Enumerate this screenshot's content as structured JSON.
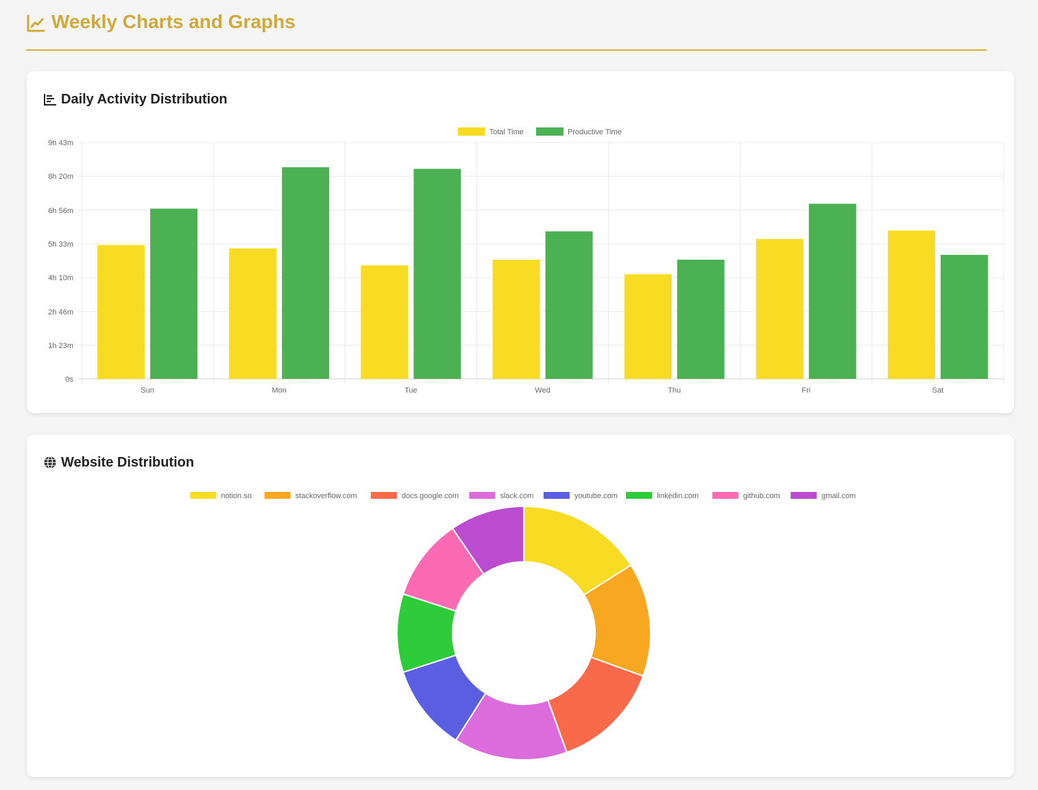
{
  "header": {
    "title": "Weekly Charts and Graphs",
    "icon": "line-chart-icon"
  },
  "colors": {
    "accent": "#cfa93a",
    "total_time": "#f8dc24",
    "productive_time": "#4bb153"
  },
  "daily_card": {
    "title": "Daily Activity Distribution",
    "icon": "bar-chart-icon"
  },
  "website_card": {
    "title": "Website Distribution",
    "icon": "globe-icon"
  },
  "chart_data": [
    {
      "type": "bar",
      "title": "Daily Activity Distribution",
      "categories": [
        "Sun",
        "Mon",
        "Tue",
        "Wed",
        "Thu",
        "Fri",
        "Sat"
      ],
      "y_unit": "minutes",
      "ylim": [
        0,
        583
      ],
      "y_ticks": [
        0,
        83,
        166,
        250,
        333,
        416,
        500,
        583
      ],
      "y_tick_labels": [
        "0s",
        "1h 23m",
        "2h 46m",
        "4h 10m",
        "5h 33m",
        "6h 56m",
        "8h 20m",
        "9h 43m"
      ],
      "grid": true,
      "legend_position": "top",
      "series": [
        {
          "name": "Total Time",
          "color": "#f8dc24",
          "values": [
            330,
            322,
            280,
            294,
            258,
            345,
            366
          ]
        },
        {
          "name": "Productive Time",
          "color": "#4bb153",
          "values": [
            420,
            522,
            518,
            364,
            294,
            432,
            306
          ]
        }
      ]
    },
    {
      "type": "pie",
      "subtype": "doughnut",
      "title": "Website Distribution",
      "legend_position": "top",
      "labels": [
        "notion.so",
        "stackoverflow.com",
        "docs.google.com",
        "slack.com",
        "youtube.com",
        "linkedin.com",
        "github.com",
        "gmail.com"
      ],
      "values": [
        16.0,
        14.5,
        14.0,
        14.5,
        11.0,
        10.0,
        10.5,
        9.5
      ],
      "colors": [
        "#f8dc24",
        "#f8a820",
        "#f86a4a",
        "#dc6cdc",
        "#5a5ee0",
        "#2ecc3a",
        "#fc6ab4",
        "#bb4ccf"
      ]
    }
  ]
}
